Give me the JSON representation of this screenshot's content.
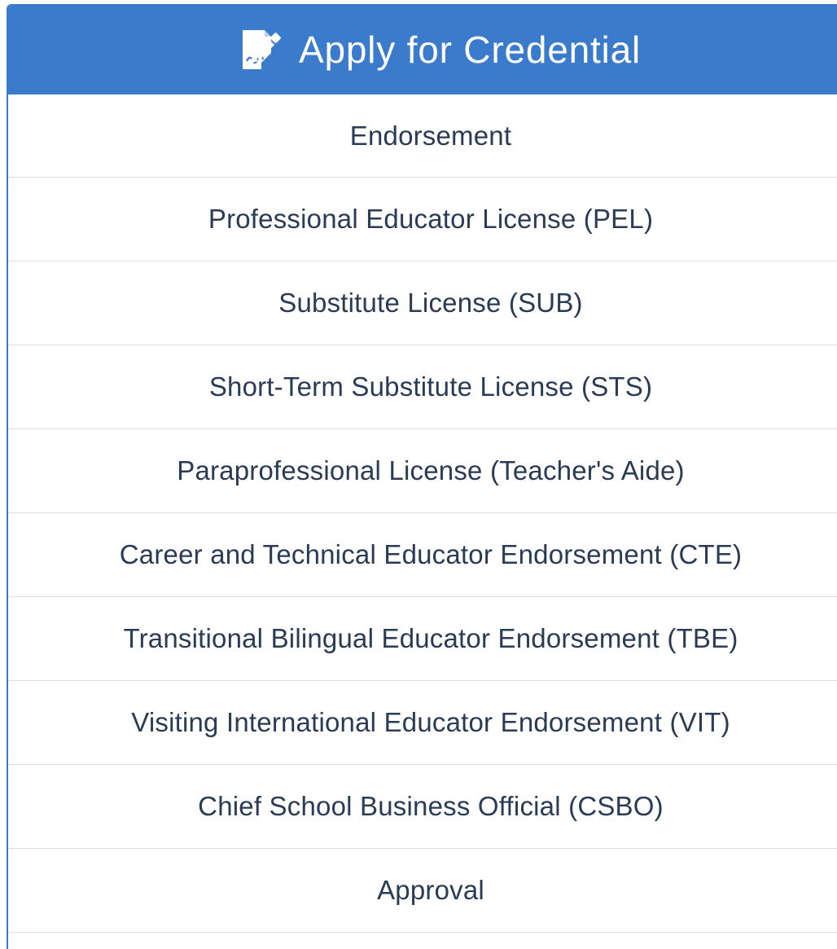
{
  "header": {
    "title": "Apply for Credential",
    "icon": "edit-document-icon",
    "background_color": "#3a7bcc"
  },
  "credentials": {
    "items": [
      {
        "label": "Endorsement"
      },
      {
        "label": "Professional Educator License (PEL)"
      },
      {
        "label": "Substitute License (SUB)"
      },
      {
        "label": "Short-Term Substitute License (STS)"
      },
      {
        "label": "Paraprofessional License (Teacher's Aide)"
      },
      {
        "label": "Career and Technical Educator Endorsement (CTE)"
      },
      {
        "label": "Transitional Bilingual Educator Endorsement (TBE)"
      },
      {
        "label": "Visiting International Educator Endorsement (VIT)"
      },
      {
        "label": "Chief School Business Official (CSBO)"
      },
      {
        "label": "Approval"
      }
    ]
  }
}
